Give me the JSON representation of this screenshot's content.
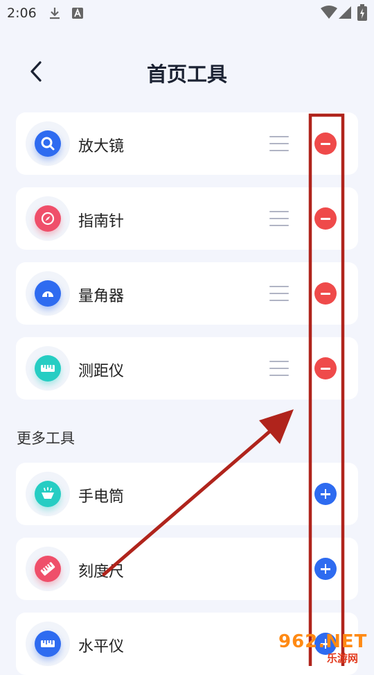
{
  "status_bar": {
    "time": "2:06",
    "icons": [
      "download-icon",
      "text-a-icon",
      "wifi-icon",
      "signal-icon",
      "battery-icon"
    ]
  },
  "header": {
    "title": "首页工具",
    "back_icon": "chevron-left-icon"
  },
  "home_tools": [
    {
      "label": "放大镜",
      "icon": "magnifier-icon",
      "color": "#2e6bf0"
    },
    {
      "label": "指南针",
      "icon": "compass-icon",
      "color": "#ef4f6a"
    },
    {
      "label": "量角器",
      "icon": "protractor-icon",
      "color": "#2e6bf0"
    },
    {
      "label": "测距仪",
      "icon": "ruler-icon",
      "color": "#26cdc3"
    }
  ],
  "more_section": {
    "title": "更多工具",
    "tools": [
      {
        "label": "手电筒",
        "icon": "flashlight-icon",
        "color": "#26cdc3"
      },
      {
        "label": "刻度尺",
        "icon": "scale-ruler-icon",
        "color": "#ef4f6a"
      },
      {
        "label": "水平仪",
        "icon": "level-icon",
        "color": "#2e6bf0"
      }
    ]
  },
  "colors": {
    "background": "#f3f5fc",
    "remove": "#ef4a4a",
    "add": "#2e6bf0",
    "annotation": "#b0241c"
  },
  "watermark": {
    "main": "962.NET",
    "sub": "乐游网"
  }
}
